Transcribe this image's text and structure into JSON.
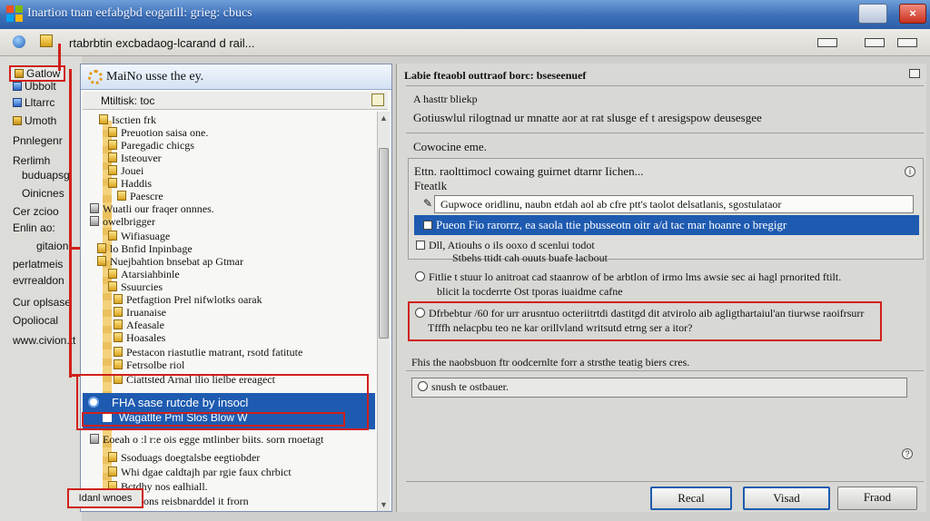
{
  "window": {
    "title": "Inartion tnan eefabgbd eogatill: grieg: cbucs",
    "close_glyph": "×"
  },
  "address_bar": {
    "text": "rtabrbtin excbadaog-lcarand d rail..."
  },
  "sidebar": {
    "items": [
      "Gatlow",
      "Ubbolt",
      "Lltarrc",
      "Umoth",
      "Pnnlegenr",
      "Rerlimh",
      "buduapsg",
      "Oinicnes",
      "Cer zcioo",
      "Enlin ao:",
      "gitaion",
      "perlatmeis",
      "evrrealdon",
      "Cur oplsase",
      "Opoliocal",
      "www.civion.tt"
    ]
  },
  "tree_panel": {
    "title": "MaiNo usse the ey.",
    "subheader": "Mtiltisk: toc",
    "rows": [
      "Isctien frk",
      "Preuotion saisa one.",
      "Paregadic chicgs",
      "Isteouver",
      "Jouei",
      "Haddis",
      "Paescre",
      "Wuatli our fraqer onnnes.",
      "owelbrigger",
      "Wifiasuage",
      "lo Bnfid Inpinbage",
      "Nuejbahtion bnsebat ap Gtmar",
      "Atarsiahbinle",
      "Ssuurcies",
      "Petfagtion Prel nifwlotks oarak",
      "Iruanaise",
      "Afeasale",
      "Hoasales",
      "Pestacon riastutlie matrant, rsotd fatitute",
      "Fetrsolbe riol",
      "Ciattsted Arnal ilio lielbe ereagect"
    ],
    "selected": {
      "line1": "FHA sase rutcde by insocl",
      "line2": "Wagatlte Pml Slos Blow W"
    },
    "highlight_row": "Eoeah o :l r:e ois egge mtlinber biits. sorn rnoetagt",
    "lower_rows": [
      "Ssoduags doegtalsbe eegtiobder",
      "Whi dgae caldtajh par rgie faux chrbict",
      "Bctdhy nos ealhiall.",
      "Pof cons reisbnarddel it frorn"
    ],
    "footer_button": "Idanl wnoes"
  },
  "right_panel": {
    "header": "Labie fteaobl outtraof borc: bseseenuef",
    "section1_label": "A hasttr bliekp",
    "section1_text": "Gotiuswlul rilogtnad ur mnatte aor at rat slusge ef t aresigspow deusesgee",
    "section2_label": "Cowocine eme.",
    "group": {
      "title": "Ettn. raolttimocl cowaing guirnet dtarnr Iichen...",
      "subtitle": "Fteatlk",
      "input_value": "Gupwoce oridlinu, naubn etdah aol ab cfre ptt's taolot delsatlanis, sgostulataor",
      "selected_option": "Pueon Fio rarorrz, ea saola ttie pbusseotn oitr a/d tac mar hoanre o bregigr",
      "option3_line1": "Dll, Atiouhs o ils ooxo d scenlui todot",
      "option3_line2": "Stbehs ttidt cah ouuts buafe lacbout"
    },
    "radio_a_line1": "Fitlie t stuur lo anitroat cad staanrow of be arbtlon of irmo  lms awsie sec ai hagl prnorited ftilt.",
    "radio_a_line2": "blicit la tocderrte Ost tporas iuaidme cafne",
    "radio_b_line1": "Dfrbebtur /60 for urr arusntuo octeriitrtdi dastitgd dit atvirolo aib agligthartaiul'an tiurwse raoifrsurr",
    "radio_b_line2": "Tfffh nelacpbu teo ne kar orillvland writsutd etrng ser a itor?",
    "footer_text": "Fhis the naobsbuon ftr oodcernlte forr a strsthe teatig biers cres.",
    "search_box_value": "snush te ostbauer.",
    "buttons": {
      "recal": "Recal",
      "vised": "Visad",
      "fred": "Fraod"
    }
  }
}
